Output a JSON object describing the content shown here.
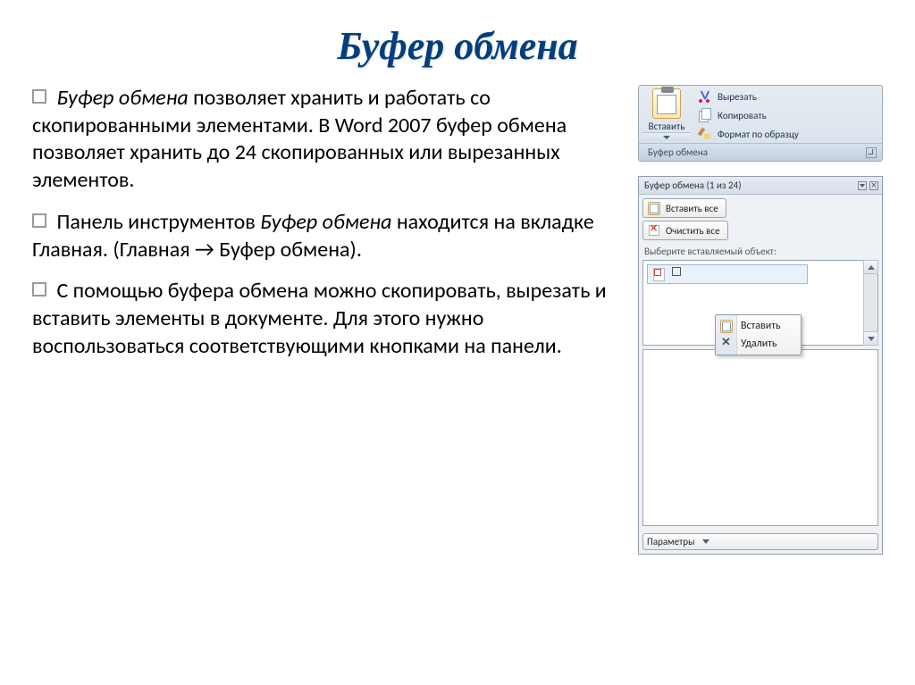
{
  "title": "Буфер обмена",
  "bullets": {
    "b1": {
      "prefix": "Буфер обмена",
      "text": " позволяет хранить и работать со скопированными элементами. В Word 2007 буфер обмена позволяет хранить до 24 скопированных или вырезанных элементов."
    },
    "b2": {
      "pre": "Панель инструментов ",
      "em": "Буфер обмена",
      "post": " находится на вкладке Главная.  (Главная → Буфер обмена)."
    },
    "b3": {
      "text": "С помощью буфера обмена можно скопировать, вырезать и вставить элементы в документе. Для этого нужно воспользоваться соответствующими кнопками на панели."
    }
  },
  "ribbon": {
    "paste": "Вставить",
    "cut": "Вырезать",
    "copy": "Копировать",
    "format_painter": "Формат по образцу",
    "group_title": "Буфер обмена"
  },
  "pane": {
    "title": "Буфер обмена (1 из 24)",
    "paste_all": "Вставить все",
    "clear_all": "Очистить все",
    "hint": "Выберите вставляемый объект:",
    "ctx_paste": "Вставить",
    "ctx_delete": "Удалить",
    "options": "Параметры"
  }
}
